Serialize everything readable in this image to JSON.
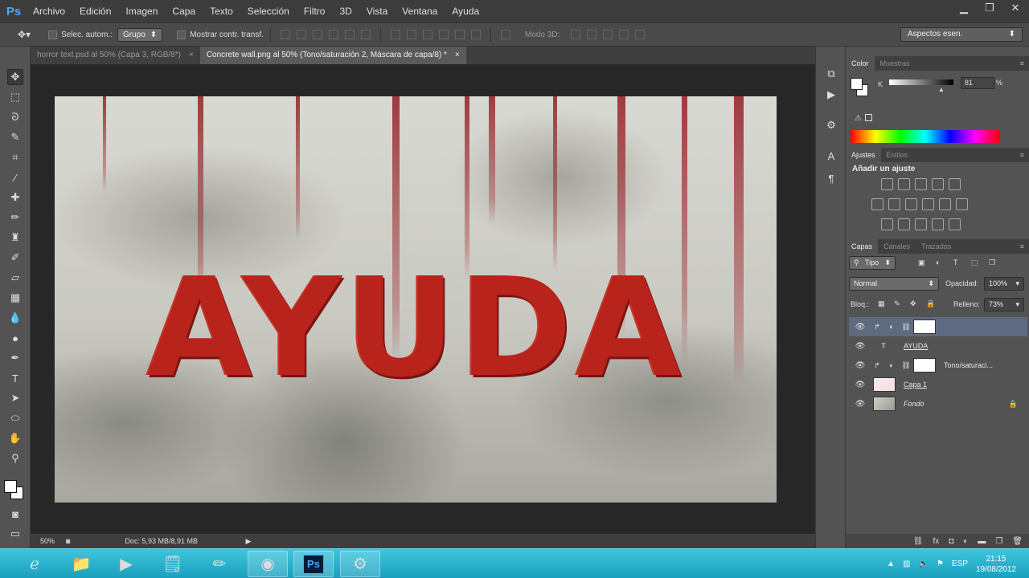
{
  "app": {
    "logo": "Ps"
  },
  "menu": [
    "Archivo",
    "Edición",
    "Imagen",
    "Capa",
    "Texto",
    "Selección",
    "Filtro",
    "3D",
    "Vista",
    "Ventana",
    "Ayuda"
  ],
  "options": {
    "auto_select_label": "Selec. autom.:",
    "auto_select_value": "Grupo",
    "show_transform_label": "Mostrar contr. transf.",
    "mode_3d_label": "Modo 3D:",
    "workspace": "Aspectos esen."
  },
  "tabs": [
    {
      "label": "horror text.psd al 50% (Capa 3, RGB/8*)",
      "close": "×",
      "active": false
    },
    {
      "label": "Concrete wall.png al 50% (Tono/saturación 2, Máscara de capa/8) *",
      "close": "×",
      "active": true
    }
  ],
  "canvas": {
    "text": "AYUDA"
  },
  "status": {
    "zoom": "50%",
    "doc": "Doc: 5,93 MB/8,91 MB",
    "arrow": "▶"
  },
  "color_panel": {
    "tabs": [
      "Color",
      "Muestras"
    ],
    "channel": "K",
    "value": "81",
    "unit": "%"
  },
  "adjustments_panel": {
    "tabs": [
      "Ajustes",
      "Estilos"
    ],
    "title": "Añadir un ajuste"
  },
  "layers_panel": {
    "tabs": [
      "Capas",
      "Canales",
      "Trazados"
    ],
    "filter": "Tipo",
    "blend_mode": "Normal",
    "opacity_label": "Opacidad:",
    "opacity_value": "100%",
    "lock_label": "Bloq.:",
    "fill_label": "Relleno:",
    "fill_value": "73%",
    "layers": [
      {
        "name": "",
        "type": "adjustment",
        "selected": true
      },
      {
        "name": "AYUDA",
        "type": "text",
        "selected": false
      },
      {
        "name": "Tono/saturaci...",
        "type": "adjustment",
        "selected": false
      },
      {
        "name": "Capa 1",
        "type": "pixel",
        "selected": false
      },
      {
        "name": "Fondo",
        "type": "background",
        "selected": false
      }
    ]
  },
  "taskbar": {
    "lang": "ESP",
    "time": "21:15",
    "date": "19/08/2012"
  },
  "colors": {
    "menubar": "#3c3c3c",
    "panel_bg": "#535353",
    "canvas_bg": "#272727",
    "blood_red": "#b8231c",
    "selection": "#5e6a80",
    "taskbar": "#1aa0bf"
  }
}
